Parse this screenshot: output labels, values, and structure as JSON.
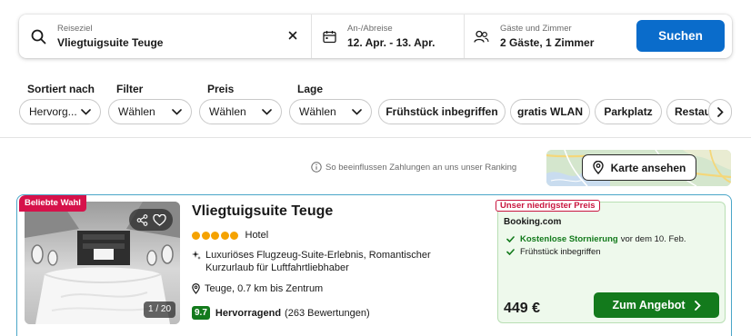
{
  "search": {
    "destination_label": "Reiseziel",
    "destination_value": "Vliegtuigsuite Teuge",
    "dates_label": "An-/Abreise",
    "dates_value": "12. Apr. - 13. Apr.",
    "guests_label": "Gäste und Zimmer",
    "guests_value": "2 Gäste, 1 Zimmer",
    "search_button": "Suchen"
  },
  "filters": {
    "sort_label": "Sortiert nach",
    "sort_value": "Hervorg...",
    "filter_label": "Filter",
    "filter_value": "Wählen",
    "price_label": "Preis",
    "price_value": "Wählen",
    "location_label": "Lage",
    "location_value": "Wählen",
    "chips": [
      "Frühstück inbegriffen",
      "gratis WLAN",
      "Parkplatz",
      "Restau"
    ]
  },
  "info_text": "So beeinflussen Zahlungen an uns unser Ranking",
  "map_button": "Karte ansehen",
  "hotel": {
    "badge": "Beliebte Wahl",
    "photo_count": "1 / 20",
    "name": "Vliegtuigsuite Teuge",
    "star_count": 5,
    "type": "Hotel",
    "description": "Luxuriöses Flugzeug-Suite-Erlebnis, Romantischer Kurzurlaub für Luftfahrtliebhaber",
    "location": "Teuge, 0.7 km bis Zentrum",
    "score": "9.7",
    "score_word": "Hervorragend",
    "reviews": "(263 Bewertungen)"
  },
  "deal": {
    "badge": "Unser niedrigster Preis",
    "provider": "Booking.com",
    "perk1_bold": "Kostenlose Stornierung",
    "perk1_rest": "vor dem 10. Feb.",
    "perk2": "Frühstück inbegriffen",
    "price": "449 €",
    "cta": "Zum Angebot"
  },
  "colors": {
    "accent": "#0a6ccb",
    "deal_green": "#137a1c",
    "popular_badge": "#d6114a",
    "star": "#f5a200"
  }
}
